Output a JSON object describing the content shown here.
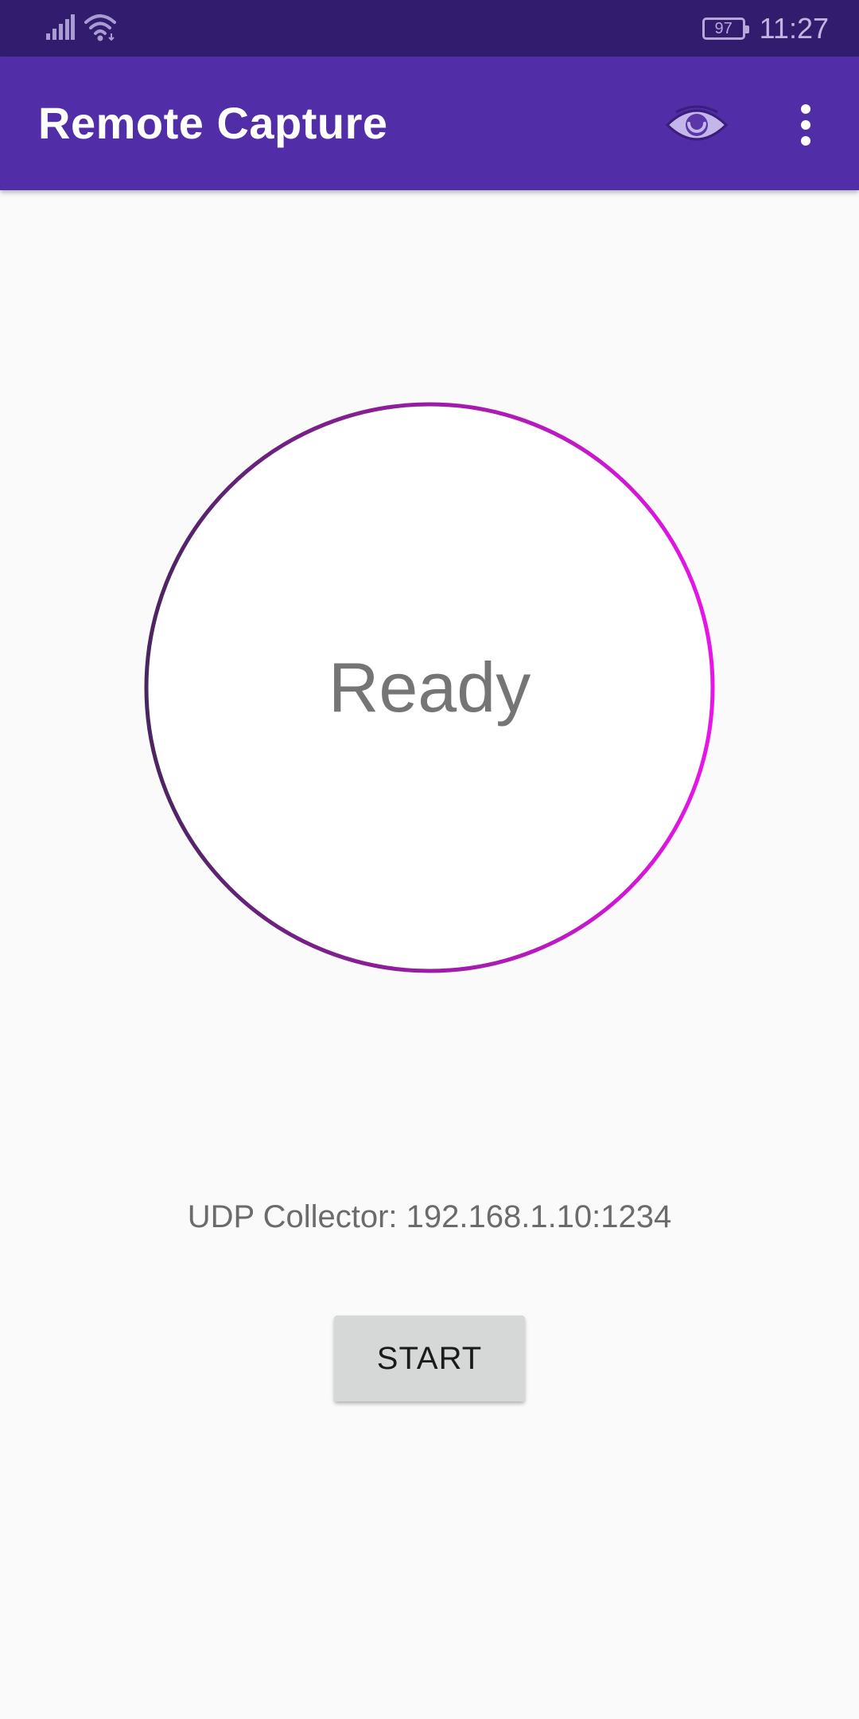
{
  "status_bar": {
    "battery_level": "97",
    "time": "11:27",
    "icons": [
      "signal-icon",
      "wifi-icon",
      "battery-icon"
    ]
  },
  "app_bar": {
    "title": "Remote Capture",
    "icons": [
      "eye-icon",
      "more-vert-icon"
    ],
    "background_color": "#512da8"
  },
  "main": {
    "status_text": "Ready",
    "collector_text": "UDP Collector: 192.168.1.10:1234",
    "start_label": "START",
    "ring_gradient": [
      "#4a2560",
      "#e815e8"
    ]
  }
}
